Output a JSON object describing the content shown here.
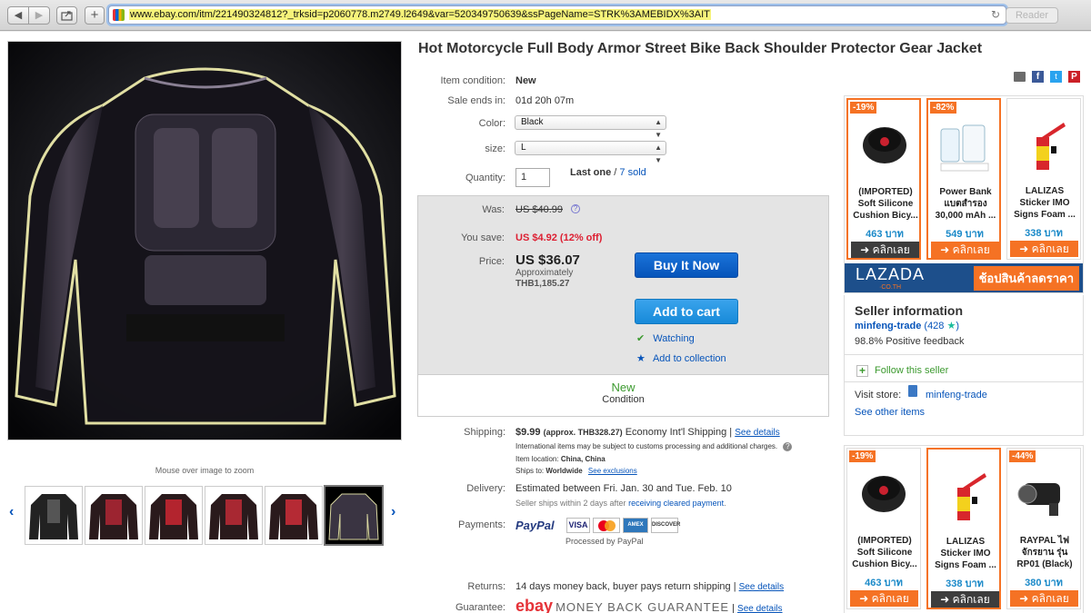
{
  "browser": {
    "url": "www.ebay.com/itm/221490324812?_trksid=p2060778.m2749.l2649&var=520349750639&ssPageName=STRK%3AMEBIDX%3AIT",
    "reader_label": "Reader"
  },
  "gallery": {
    "zoom_hint": "Mouse over image to zoom",
    "thumb_count": 6
  },
  "item": {
    "title": "Hot Motorcycle Full Body Armor Street Bike Back Shoulder Protector Gear Jacket",
    "condition_label": "Item condition:",
    "condition_value": "New",
    "sale_ends_label": "Sale ends in:",
    "sale_ends_value": "01d 20h 07m",
    "color_label": "Color:",
    "color_value": "Black",
    "size_label": "size:",
    "size_value": "L",
    "quantity_label": "Quantity:",
    "quantity_value": "1",
    "last_one": "Last one",
    "sold_sep": "/",
    "sold": "7 sold"
  },
  "pricing": {
    "was_label": "Was:",
    "was_value": "US $40.99",
    "save_label": "You save:",
    "save_value": "US $4.92 (12% off)",
    "price_label": "Price:",
    "price_value": "US $36.07",
    "approx_label": "Approximately",
    "approx_value": "THB1,185.27",
    "buy_now": "Buy It Now",
    "add_to_cart": "Add to cart",
    "watching": "Watching",
    "add_to_collection": "Add to collection",
    "new_label": "New",
    "condition_caption": "Condition"
  },
  "shipping": {
    "label": "Shipping:",
    "cost": "$9.99",
    "approx": "(approx. THB328.27)",
    "service": "Economy Int'l Shipping",
    "see_details": "See details",
    "note": "International items may be subject to customs processing and additional charges.",
    "location_label": "Item location:",
    "location_value": "China, China",
    "ships_to_label": "Ships to:",
    "ships_to_value": "Worldwide",
    "see_exclusions": "See exclusions"
  },
  "delivery": {
    "label": "Delivery:",
    "estimate": "Estimated between Fri. Jan. 30 and Tue. Feb. 10",
    "note_prefix": "Seller ships within 2 days after",
    "note_link": "receiving cleared payment",
    "note_suffix": "."
  },
  "payments": {
    "label": "Payments:",
    "paypal": "PayPal",
    "processed": "Processed by PayPal",
    "cards": [
      "VISA",
      "MC",
      "AMEX",
      "DISCOVER"
    ]
  },
  "returns": {
    "label": "Returns:",
    "value": "14 days money back, buyer pays return shipping",
    "see_details": "See details"
  },
  "guarantee": {
    "label": "Guarantee:",
    "brand": "ebay",
    "text": "MONEY BACK GUARANTEE",
    "see_details": "See details"
  },
  "ads_top": [
    {
      "discount": "-19%",
      "name": "(IMPORTED) Soft Silicone Cushion Bicy...",
      "price": "463 บาท",
      "cta": "คลิกเลย",
      "icon": "bike-saddle-icon",
      "highlight": true,
      "dark": true
    },
    {
      "discount": "-82%",
      "name": "Power Bank แบตสำรอง 30,000 mAh ...",
      "price": "549 บาท",
      "cta": "คลิกเลย",
      "icon": "power-bank-icon",
      "highlight": true,
      "dark": false
    },
    {
      "discount": "",
      "name": "LALIZAS Sticker IMO Signs Foam ...",
      "price": "338 บาท",
      "cta": "คลิกเลย",
      "icon": "fire-extinguisher-sign-icon",
      "highlight": false,
      "dark": false
    }
  ],
  "ads_bottom": [
    {
      "discount": "-19%",
      "name": "(IMPORTED) Soft Silicone Cushion Bicy...",
      "price": "463 บาท",
      "cta": "คลิกเลย",
      "icon": "bike-saddle-icon",
      "highlight": false,
      "dark": false
    },
    {
      "discount": "",
      "name": "LALIZAS Sticker IMO Signs Foam ...",
      "price": "338 บาท",
      "cta": "คลิกเลย",
      "icon": "fire-extinguisher-sign-icon",
      "highlight": true,
      "dark": true
    },
    {
      "discount": "-44%",
      "name": "RAYPAL ไฟ จักรยาน รุ่น RP01 (Black)",
      "price": "380 บาท",
      "cta": "คลิกเลย",
      "icon": "bike-light-icon",
      "highlight": false,
      "dark": false
    }
  ],
  "lazada": {
    "logo": "LAZADA",
    "sub": "·CO.TH",
    "cta": "ช้อปสินค้าลดราคา"
  },
  "seller": {
    "heading": "Seller information",
    "name": "minfeng-trade",
    "score": "(428",
    "score_close": ")",
    "feedback": "98.8% Positive feedback",
    "follow": "Follow this seller",
    "visit_store_label": "Visit store:",
    "store_name": "minfeng-trade",
    "see_other": "See other items"
  },
  "colors": {
    "ebay_blue": "#0654ba",
    "sale_red": "#dd1e31",
    "lazada_orange": "#f57224",
    "lazada_blue": "#1d4f8b"
  }
}
